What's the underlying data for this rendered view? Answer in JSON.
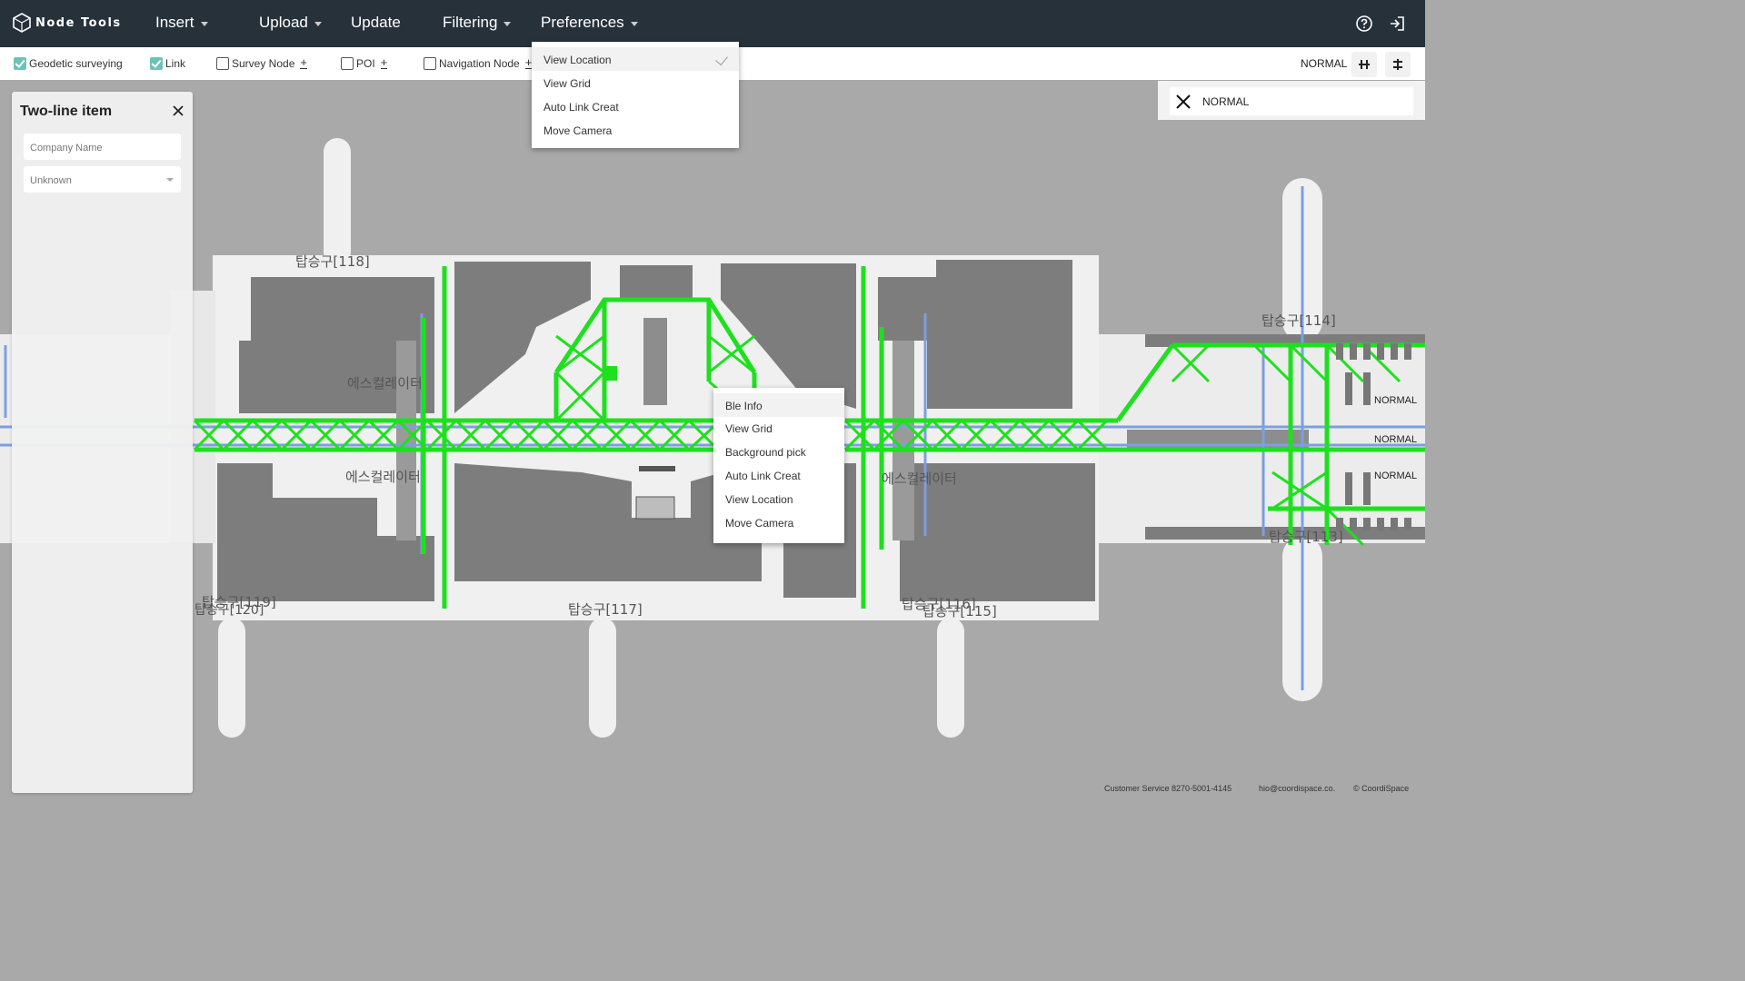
{
  "app": {
    "title": "Node Tools"
  },
  "menu": {
    "insert": "Insert",
    "upload": "Upload",
    "update": "Update",
    "filtering": "Filtering",
    "preferences": "Preferences"
  },
  "icons": {
    "logo": "hexagon-cube-icon",
    "help": "help-circle-icon",
    "logout": "exit-icon",
    "close": "close-icon",
    "check": "check-icon"
  },
  "filters": {
    "geodetic": {
      "label": "Geodetic surveying",
      "checked": true
    },
    "link": {
      "label": "Link",
      "checked": true
    },
    "survey_node": {
      "label": "Survey Node",
      "checked": false,
      "add": "+"
    },
    "poi": {
      "label": "POI",
      "checked": false,
      "add": "+"
    },
    "nav_node": {
      "label": "Navigation Node",
      "checked": false,
      "add": "+"
    }
  },
  "mode": {
    "label": "NORMAL"
  },
  "preferences_menu": {
    "items": [
      "View Location",
      "View Grid",
      "Auto Link Creat",
      "Move Camera"
    ],
    "checked_item": "View Location"
  },
  "left_panel": {
    "title": "Two-line item",
    "company_placeholder": "Company Name",
    "select_value": "Unknown"
  },
  "right_panel": {
    "label": "NORMAL"
  },
  "context_menu": {
    "items": [
      "Ble Info",
      "View Grid",
      "Background pick",
      "Auto Link Creat",
      "View Location",
      "Move Camera"
    ]
  },
  "map": {
    "labels": {
      "gate118": "탑승구[118]",
      "gate117": "탑승구[117]",
      "gate119": "탑승구[119]",
      "gate120": "탑승구[120]",
      "gate116": "탑승구[116]",
      "gate115": "탑승구[115]",
      "gate114": "탑승구[114]",
      "gate113": "탑승구[113]",
      "escalator": "에스컬레이터"
    },
    "side_modes": [
      "NORMAL",
      "NORMAL",
      "NORMAL"
    ],
    "colors": {
      "link": "#1ee01e",
      "path": "#7b9fe0",
      "building": "#7d7d7d",
      "floor": "#f0f0f0"
    }
  },
  "footer": {
    "service": "Customer Service 8270-5001-4145",
    "email": "hio@coordispace.co.",
    "copyright": "© CoordiSpace"
  }
}
